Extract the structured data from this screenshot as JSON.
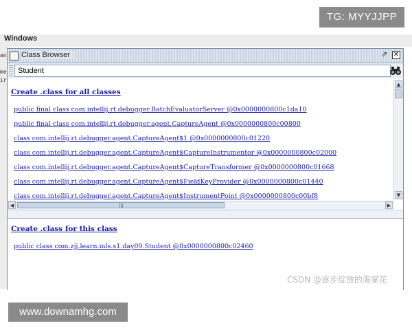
{
  "overlays": {
    "tg_badge": "TG: MYYJJPP",
    "site_badge": "www.downamhg.com",
    "csdn_watermark": "CSDN @逐步绽放的海棠花"
  },
  "background_app": {
    "menu_label": "Windows",
    "left_fragments": [
      "an",
      "me",
      "ir"
    ]
  },
  "window": {
    "title": "Class Browser",
    "title_icon": "window-icon",
    "restore_icon": "restore-icon",
    "close_icon": "close-icon"
  },
  "search": {
    "value": "Student",
    "button_icon": "binoculars-icon"
  },
  "all_classes": {
    "heading": "Create .class for all classes",
    "items": [
      "public final class com.intellij.rt.debugger.BatchEvaluatorServer @0x0000000800c1da10",
      "public final class com.intellij.rt.debugger.agent.CaptureAgent @0x0000000800c00800",
      "class com.intellij.rt.debugger.agent.CaptureAgent$1 @0x0000000800c01220",
      "class com.intellij.rt.debugger.agent.CaptureAgent$CaptureInstrumentor @0x0000000800c02000",
      "class com.intellij.rt.debugger.agent.CaptureAgent$CaptureTransformer @0x0000000800c01668",
      "class com.intellij.rt.debugger.agent.CaptureAgent$FieldKeyProvider @0x0000000800c01440",
      "class com.intellij.rt.debugger.agent.CaptureAgent$InstrumentPoint @0x0000000800c00bf8"
    ]
  },
  "this_class": {
    "heading": "Create .class for this class",
    "items": [
      "public class com.zjj.learn.mls.s1.day09.Student @0x0000000800c02460"
    ]
  },
  "colors": {
    "link": "#1a1aa6",
    "border": "#7a8aa5",
    "badge_bg": "#8a8a8a"
  }
}
